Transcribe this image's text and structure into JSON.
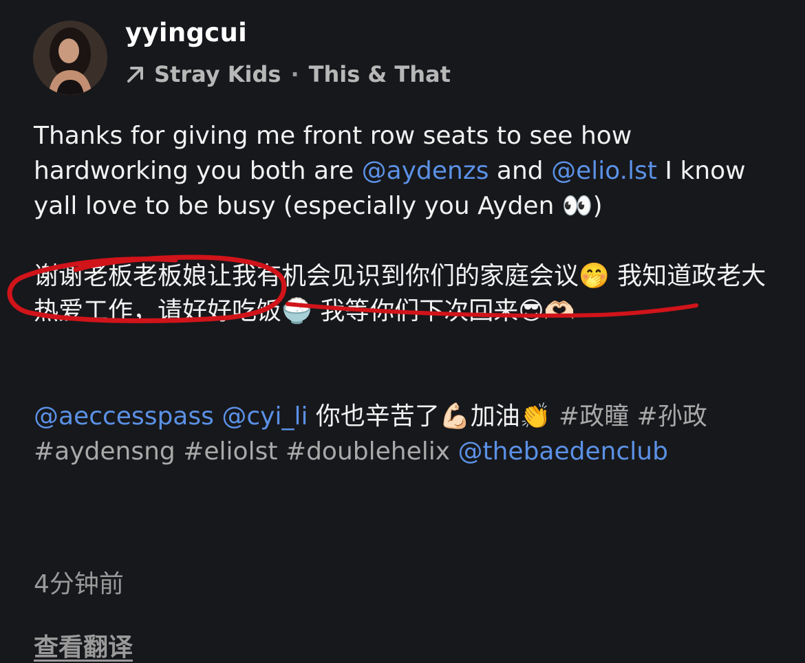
{
  "post": {
    "username": "yyingcui",
    "topic": "Stray Kids",
    "separator": "·",
    "subtopic": "This & That",
    "body": {
      "en": [
        {
          "t": "text",
          "v": "Thanks for giving me front row seats to see how hardworking you both are "
        },
        {
          "t": "mention",
          "v": "@aydenzs"
        },
        {
          "t": "text",
          "v": " and "
        },
        {
          "t": "mention",
          "v": "@elio.lst"
        },
        {
          "t": "text",
          "v": " I know yall love to be busy (especially you Ayden "
        },
        {
          "t": "emoji",
          "v": "👀"
        },
        {
          "t": "text",
          "v": ")"
        }
      ],
      "zh": [
        {
          "t": "text",
          "v": "谢谢老板老板娘让我有机会见识到你们的家庭会议"
        },
        {
          "t": "emoji",
          "v": "🤭"
        },
        {
          "t": "text",
          "v": " 我知道政老大热爱工作，请好好吃饭"
        },
        {
          "t": "emoji",
          "v": "🍚"
        },
        {
          "t": "text",
          "v": " 我等你们下次回来"
        },
        {
          "t": "emoji",
          "v": "😎"
        },
        {
          "t": "emoji",
          "v": "🫶🏻"
        }
      ],
      "tags": [
        {
          "t": "mention",
          "v": "@aeccesspass"
        },
        {
          "t": "text",
          "v": " "
        },
        {
          "t": "mention",
          "v": "@cyi_li"
        },
        {
          "t": "text",
          "v": " 你也辛苦了"
        },
        {
          "t": "emoji",
          "v": "💪🏻"
        },
        {
          "t": "text",
          "v": "加油"
        },
        {
          "t": "emoji",
          "v": "👏"
        },
        {
          "t": "text",
          "v": " "
        },
        {
          "t": "hashtag",
          "v": "#政瞳"
        },
        {
          "t": "text",
          "v": " "
        },
        {
          "t": "hashtag",
          "v": "#孙政"
        },
        {
          "t": "hashtag",
          "v": "#aydensng"
        },
        {
          "t": "text",
          "v": " "
        },
        {
          "t": "hashtag",
          "v": "#eliolst"
        },
        {
          "t": "text",
          "v": " "
        },
        {
          "t": "hashtag",
          "v": "#doublehelix"
        },
        {
          "t": "text",
          "v": " "
        },
        {
          "t": "mention",
          "v": "@thebaedenclub"
        }
      ]
    },
    "timestamp": "4分钟前",
    "translate_label": "查看翻译"
  },
  "icons": {
    "topic_arrow": "arrow-up-right-icon"
  },
  "colors": {
    "background": "#17181c",
    "mention": "#5b91e6",
    "annotation": "#d0141a"
  }
}
